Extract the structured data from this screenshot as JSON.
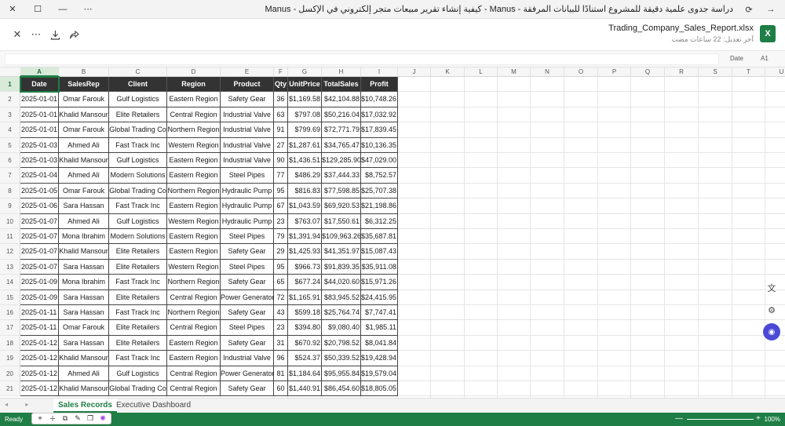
{
  "window": {
    "title": "دراسة جدوى علمية دقيقة للمشروع استنادًا للبيانات المرفقة - Manus - كيفية إنشاء تقرير مبيعات متجر إلكتروني في الإكسل - Manus",
    "more_label": "⋯"
  },
  "file": {
    "name": "Trading_Company_Sales_Report.xlsx",
    "modified": "آخر تعديل: 22 ساعات مضت",
    "app_icon_letter": "X"
  },
  "formula_bar": {
    "name_box": "A1",
    "cell_value": "Date"
  },
  "grid": {
    "columns": [
      "A",
      "B",
      "C",
      "D",
      "E",
      "F",
      "G",
      "H",
      "I",
      "J",
      "K",
      "L",
      "M",
      "N",
      "O",
      "P",
      "Q",
      "R",
      "S",
      "T",
      "U"
    ],
    "row_numbers": [
      "1",
      "2",
      "3",
      "4",
      "5",
      "6",
      "7",
      "8",
      "9",
      "10",
      "11",
      "12",
      "13",
      "14",
      "15",
      "16",
      "17",
      "18",
      "19",
      "20",
      "21"
    ],
    "headers": [
      "Date",
      "SalesRep",
      "Client",
      "Region",
      "Product",
      "Qty",
      "UnitPrice",
      "TotalSales",
      "Profit"
    ],
    "rows": [
      [
        "2025-01-01",
        "Omar Farouk",
        "Gulf Logistics",
        "Eastern Region",
        "Safety Gear",
        "36",
        "$1,169.58",
        "$42,104.88",
        "$10,748.26"
      ],
      [
        "2025-01-01",
        "Khalid Mansour",
        "Elite Retailers",
        "Central Region",
        "Industrial Valve",
        "63",
        "$797.08",
        "$50,216.04",
        "$17,032.92"
      ],
      [
        "2025-01-01",
        "Omar Farouk",
        "Global Trading Co",
        "Northern Region",
        "Industrial Valve",
        "91",
        "$799.69",
        "$72,771.79",
        "$17,839.45"
      ],
      [
        "2025-01-03",
        "Ahmed Ali",
        "Fast Track Inc",
        "Western Region",
        "Industrial Valve",
        "27",
        "$1,287.61",
        "$34,765.47",
        "$10,136.35"
      ],
      [
        "2025-01-03",
        "Khalid Mansour",
        "Gulf Logistics",
        "Eastern Region",
        "Industrial Valve",
        "90",
        "$1,436.51",
        "$129,285.90",
        "$47,029.00"
      ],
      [
        "2025-01-04",
        "Ahmed Ali",
        "Modern Solutions",
        "Eastern Region",
        "Steel Pipes",
        "77",
        "$486.29",
        "$37,444.33",
        "$8,752.57"
      ],
      [
        "2025-01-05",
        "Omar Farouk",
        "Global Trading Co",
        "Northern Region",
        "Hydraulic Pump",
        "95",
        "$816.83",
        "$77,598.85",
        "$25,707.38"
      ],
      [
        "2025-01-06",
        "Sara Hassan",
        "Fast Track Inc",
        "Eastern Region",
        "Hydraulic Pump",
        "67",
        "$1,043.59",
        "$69,920.53",
        "$21,198.86"
      ],
      [
        "2025-01-07",
        "Ahmed Ali",
        "Gulf Logistics",
        "Western Region",
        "Hydraulic Pump",
        "23",
        "$763.07",
        "$17,550.61",
        "$6,312.25"
      ],
      [
        "2025-01-07",
        "Mona Ibrahim",
        "Modern Solutions",
        "Eastern Region",
        "Steel Pipes",
        "79",
        "$1,391.94",
        "$109,963.26",
        "$35,687.81"
      ],
      [
        "2025-01-07",
        "Khalid Mansour",
        "Elite Retailers",
        "Eastern Region",
        "Safety Gear",
        "29",
        "$1,425.93",
        "$41,351.97",
        "$15,087.43"
      ],
      [
        "2025-01-07",
        "Sara Hassan",
        "Elite Retailers",
        "Western Region",
        "Steel Pipes",
        "95",
        "$966.73",
        "$91,839.35",
        "$35,911.08"
      ],
      [
        "2025-01-09",
        "Mona Ibrahim",
        "Fast Track Inc",
        "Northern Region",
        "Safety Gear",
        "65",
        "$677.24",
        "$44,020.60",
        "$15,971.26"
      ],
      [
        "2025-01-09",
        "Sara Hassan",
        "Elite Retailers",
        "Central Region",
        "Power Generator",
        "72",
        "$1,165.91",
        "$83,945.52",
        "$24,415.95"
      ],
      [
        "2025-01-11",
        "Sara Hassan",
        "Fast Track Inc",
        "Northern Region",
        "Safety Gear",
        "43",
        "$599.18",
        "$25,764.74",
        "$7,747.41"
      ],
      [
        "2025-01-11",
        "Omar Farouk",
        "Elite Retailers",
        "Central Region",
        "Steel Pipes",
        "23",
        "$394.80",
        "$9,080.40",
        "$1,985.11"
      ],
      [
        "2025-01-12",
        "Sara Hassan",
        "Elite Retailers",
        "Eastern Region",
        "Safety Gear",
        "31",
        "$670.92",
        "$20,798.52",
        "$8,041.84"
      ],
      [
        "2025-01-12",
        "Khalid Mansour",
        "Fast Track Inc",
        "Eastern Region",
        "Industrial Valve",
        "96",
        "$524.37",
        "$50,339.52",
        "$19,428.94"
      ],
      [
        "2025-01-12",
        "Ahmed Ali",
        "Gulf Logistics",
        "Central Region",
        "Power Generator",
        "81",
        "$1,184.64",
        "$95,955.84",
        "$19,579.04"
      ],
      [
        "2025-01-12",
        "Khalid Mansour",
        "Global Trading Co",
        "Central Region",
        "Safety Gear",
        "60",
        "$1,440.91",
        "$86,454.60",
        "$18,805.05"
      ]
    ]
  },
  "sheets": {
    "tabs": [
      "Sales Records",
      "Executive Dashboard"
    ],
    "active": "Sales Records",
    "nav_arrows": "◂ ▸"
  },
  "status": {
    "ready": "Ready",
    "zoom": "100%",
    "zoom_minus": "—",
    "zoom_plus": "+"
  },
  "icons": {
    "close": "close-icon",
    "download": "download-icon",
    "share": "share-icon",
    "refresh": "refresh-icon",
    "forward": "arrow-right-icon"
  },
  "colors": {
    "excel_green": "#1e7e45",
    "header_dark": "#333333"
  }
}
